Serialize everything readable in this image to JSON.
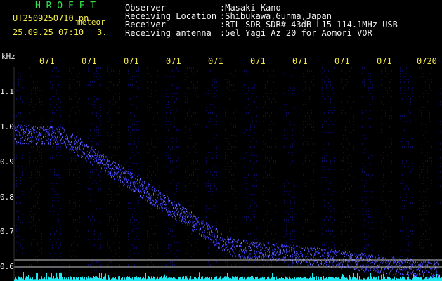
{
  "header": {
    "app_title": "H R O F F T",
    "file_name": "UT2509250710.pn",
    "label_meteor": "meteor",
    "datetime": "25.09.25 07:10",
    "count": "3."
  },
  "info": {
    "observer_label": "Observer",
    "observer_value": ":Masaki Kano",
    "location_label": "Receiving Location",
    "location_value": ":Shibukawa,Gunma,Japan",
    "receiver_label": "Receiver",
    "receiver_value": ":RTL-SDR SDR# 43dB L15 114.1MHz USB",
    "antenna_label": "Receiving antenna",
    "antenna_value": ":5el Yagi Az 20 for Aomori VOR"
  },
  "axis": {
    "unit": "kHz",
    "freq_ticks": [
      "1.1",
      "1.0",
      "0.9",
      "0.8",
      "0.7",
      "0.6"
    ],
    "time_ticks": [
      "071",
      "071",
      "071",
      "071",
      "071",
      "071",
      "071",
      "071",
      "071",
      "0720"
    ]
  },
  "colors": {
    "background": "#000000",
    "title_green": "#33e24a",
    "text_yellow": "#f2e94a",
    "text_white": "#f4f4f4",
    "signal_blue": "#3a3cff",
    "noise_blue": "#0c0c56",
    "baseline_cyan": "#20e8f0"
  }
}
